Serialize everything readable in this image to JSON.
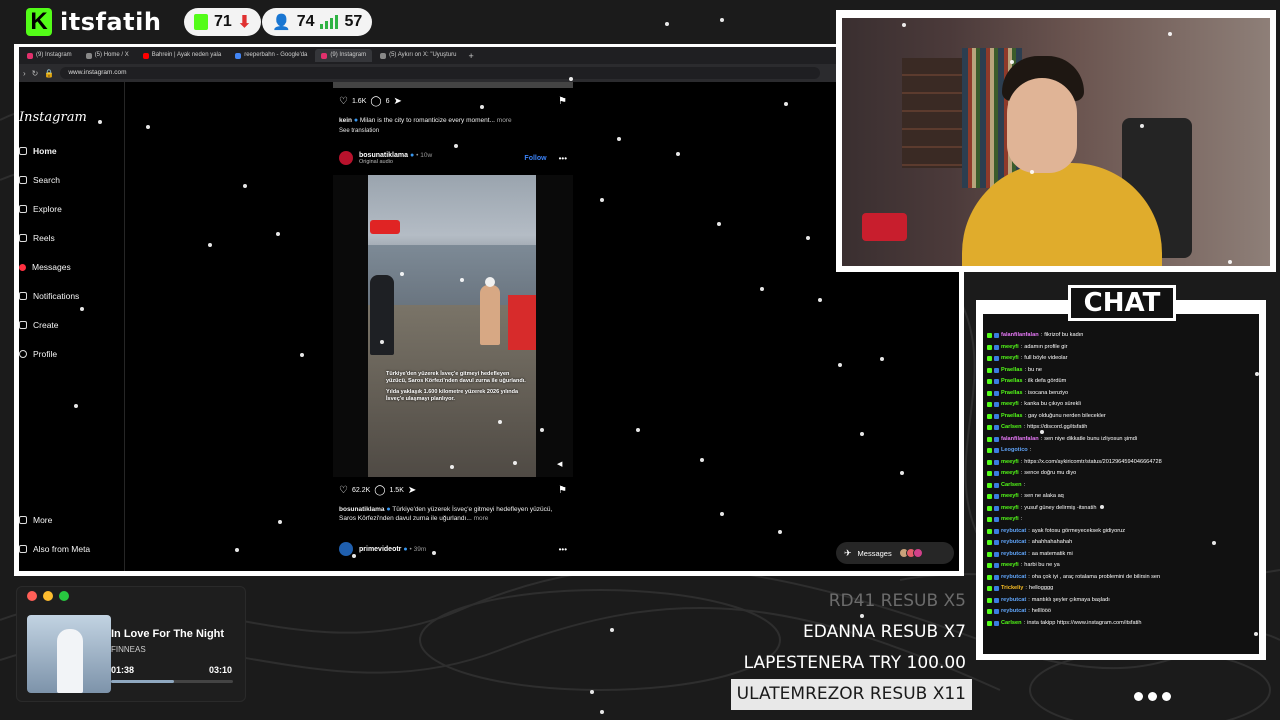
{
  "brand": {
    "name": "itsfatih",
    "logo_letter": "K"
  },
  "stats": {
    "rank_value": "71",
    "viewers": "74",
    "signal": "57"
  },
  "browser": {
    "tabs": [
      {
        "label": "(9) Instagram",
        "color": "#e1306c"
      },
      {
        "label": "(5) Home / X",
        "color": "#888888"
      },
      {
        "label": "Bahrein | Ayak neden yala",
        "color": "#ff0000"
      },
      {
        "label": "reeperbahn - Google'da",
        "color": "#4285f4"
      },
      {
        "label": "(9) Instagram",
        "color": "#e1306c"
      },
      {
        "label": "(5) Aykırı on X: \"Uyuşturu",
        "color": "#888888"
      }
    ],
    "url": "www.instagram.com"
  },
  "instagram": {
    "logo": "Instagram",
    "nav": [
      {
        "label": "Home",
        "icon": "home-icon",
        "bold": true
      },
      {
        "label": "Search",
        "icon": "search-icon"
      },
      {
        "label": "Explore",
        "icon": "explore-icon"
      },
      {
        "label": "Reels",
        "icon": "reels-icon"
      },
      {
        "label": "Messages",
        "icon": "messages-icon",
        "badge": true
      },
      {
        "label": "Notifications",
        "icon": "heart-icon"
      },
      {
        "label": "Create",
        "icon": "plus-icon"
      },
      {
        "label": "Profile",
        "icon": "profile-icon"
      }
    ],
    "nav_bottom": {
      "more": "More",
      "meta": "Also from Meta"
    },
    "prev_post": {
      "likes": "1.6K",
      "comments": "6",
      "caption_user": "kein",
      "caption_text": "Milan is the city to romanticize every moment...",
      "more": "more",
      "see_translation": "See translation"
    },
    "post": {
      "user": "bosunatiklama",
      "time": "10w",
      "sub": "Original audio",
      "follow": "Follow",
      "video_text_1": "Türkiye'den yüzerek İsveç'e gitmeyi hedefleyen yüzücü, Saros Körfezi'nden davul zurna ile uğurlandı.",
      "video_text_2": "Yılda yaklaşık 1.600 kilometre yüzerek 2026 yılında İsveç'e ulaşmayı planlıyor.",
      "likes": "62.2K",
      "comments": "1.5K",
      "caption_user": "bosunatiklama",
      "caption_text": "Türkiye'den yüzerek İsveç'e gitmeyi hedefleyen yüzücü, Saros Körfezi'nden davul zurna ile uğurlandı...",
      "more": "more"
    },
    "next_post": {
      "user": "primevideotr",
      "time": "39m"
    },
    "messages_label": "Messages"
  },
  "chat": {
    "title": "CHAT",
    "messages": [
      {
        "user": "falanfilanfalan",
        "text": "fikrizof bu kadın",
        "color": "#e879f9"
      },
      {
        "user": "meeyfi",
        "text": "adamın profile gir",
        "color": "#53fc18"
      },
      {
        "user": "meeyfi",
        "text": "full böyle videolar",
        "color": "#53fc18"
      },
      {
        "user": "Praellas",
        "text": "bu ne",
        "color": "#53fc18"
      },
      {
        "user": "Praellas",
        "text": "ilk defa gördüm",
        "color": "#53fc18"
      },
      {
        "user": "Praellas",
        "text": "isocana benziyo",
        "color": "#53fc18"
      },
      {
        "user": "meeyfi",
        "text": "kanka bu çıkıyo sürekli",
        "color": "#53fc18"
      },
      {
        "user": "Praellas",
        "text": "gay olduğunu nerden bilecekler",
        "color": "#53fc18"
      },
      {
        "user": "Carlsen",
        "text": "https://discord.gg/itsfatih",
        "color": "#53fc18"
      },
      {
        "user": "falanfilanfalan",
        "text": "sen niye dikkatle bunu izliyosun şimdi",
        "color": "#e879f9"
      },
      {
        "user": "Leogotico",
        "text": "",
        "color": "#60a5fa"
      },
      {
        "user": "meeyfi",
        "text": "https://x.com/aykiricomtr/status/2012964594046664728",
        "color": "#53fc18"
      },
      {
        "user": "meeyfi",
        "text": "sence doğru mu diyo",
        "color": "#53fc18"
      },
      {
        "user": "Carlsen",
        "text": "",
        "color": "#53fc18"
      },
      {
        "user": "meeyfi",
        "text": "sen ne alaka aq",
        "color": "#53fc18"
      },
      {
        "user": "meeyfi",
        "text": "yusuf güney delirmiş -itsnatih",
        "color": "#53fc18"
      },
      {
        "user": "meeyfi",
        "text": "",
        "color": "#53fc18"
      },
      {
        "user": "reybutcat",
        "text": "ayak fotosu görmeyeceksek gidiyoruz",
        "color": "#60a5fa"
      },
      {
        "user": "reybutcat",
        "text": "ahahhahahahah",
        "color": "#60a5fa"
      },
      {
        "user": "reybutcat",
        "text": "aa matematik mi",
        "color": "#60a5fa"
      },
      {
        "user": "meeyfi",
        "text": "harbi bu ne ya",
        "color": "#53fc18"
      },
      {
        "user": "reybutcat",
        "text": "oha çok iyi , araç rotalama problemini de bilirsin sen",
        "color": "#60a5fa"
      },
      {
        "user": "Trickeliy",
        "text": "hellogggg",
        "color": "#fbbf24"
      },
      {
        "user": "reybutcat",
        "text": "mantıklı şeyler çıkmaya başladı",
        "color": "#60a5fa"
      },
      {
        "user": "reybutcat",
        "text": "helllööö",
        "color": "#60a5fa"
      },
      {
        "user": "Carlsen",
        "text": "insta takipp https://www.instagram.com/itsfatih",
        "color": "#53fc18"
      }
    ]
  },
  "player": {
    "song": "In Love For The Night",
    "artist": "FINNEAS",
    "elapsed": "01:38",
    "duration": "03:10",
    "progress": 0.52
  },
  "alerts": [
    {
      "text": "RD41  RESUB X5",
      "style": "faded"
    },
    {
      "text": "EDANNA  RESUB X7",
      "style": "normal"
    },
    {
      "text": "LAPESTENERA  TRY 100.00",
      "style": "normal"
    },
    {
      "text": "ULATEMREZOR  RESUB X11",
      "style": "highlight"
    }
  ]
}
